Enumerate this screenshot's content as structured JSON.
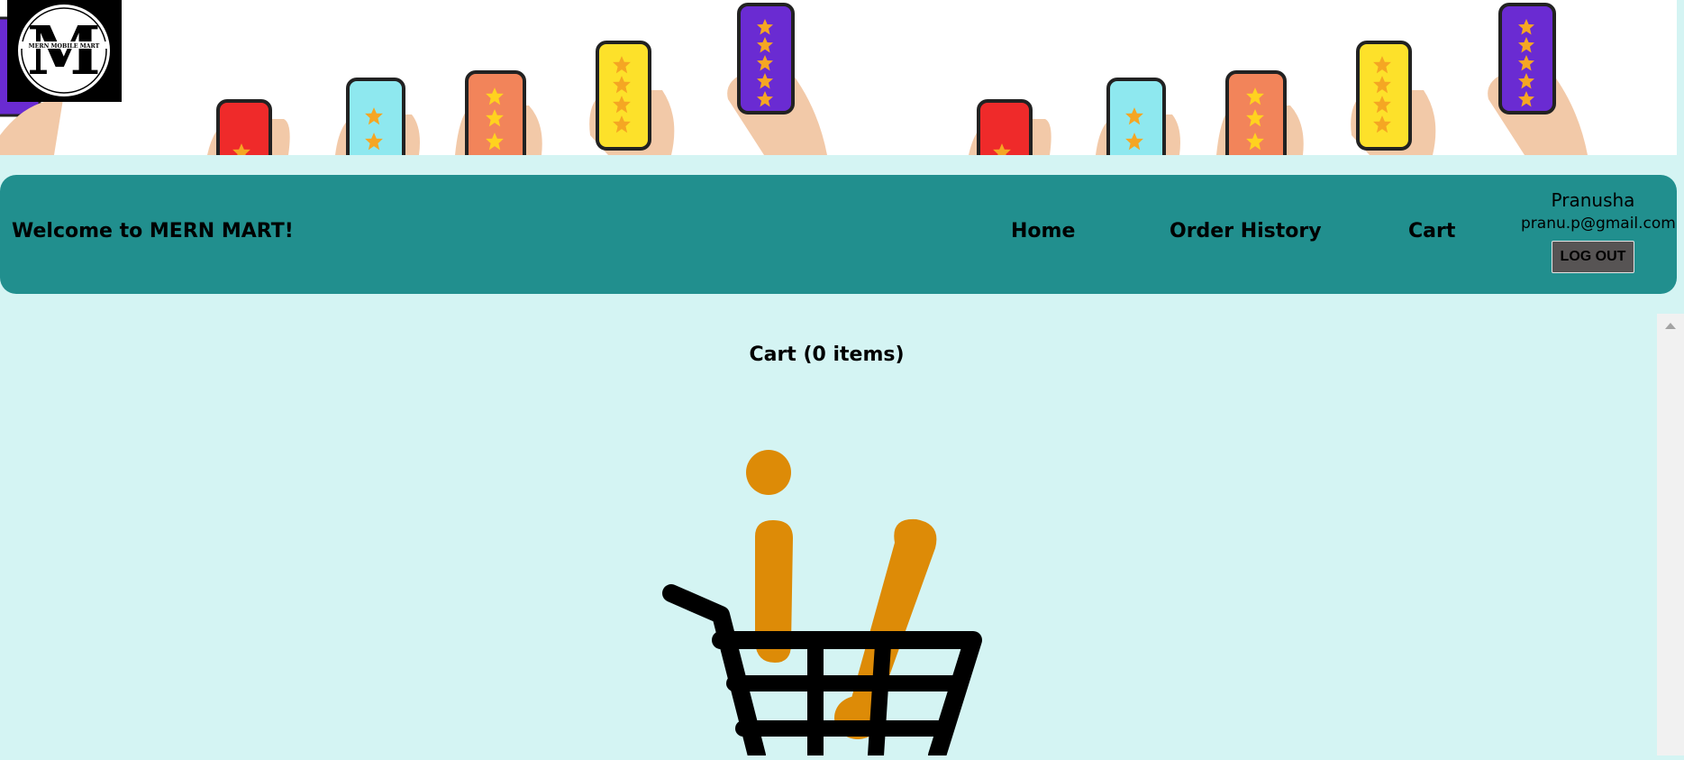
{
  "logo": {
    "text": "MERN MOBILE MART",
    "icon": "logo-icon"
  },
  "navbar": {
    "welcome": "Welcome to MERN MART!",
    "links": [
      "Home",
      "Order History",
      "Cart"
    ],
    "user": {
      "name": "Pranusha",
      "email": "pranu.p@gmail.com"
    },
    "logout_label": "LOG OUT"
  },
  "cart": {
    "title": "Cart (0 items)",
    "empty_icon": "empty-cart-icon"
  },
  "colors": {
    "background": "#d4f4f3",
    "navbar": "#218f8e",
    "logout_button": "#575454",
    "accent_orange": "#dd8b07"
  }
}
